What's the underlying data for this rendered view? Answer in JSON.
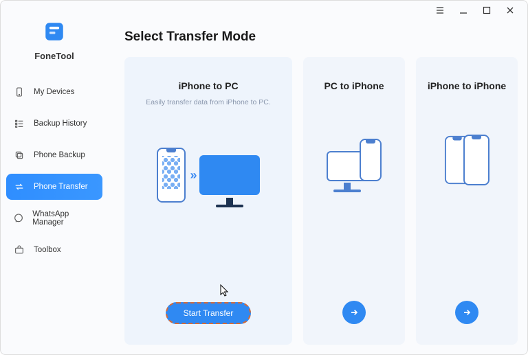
{
  "app": {
    "name": "FoneTool"
  },
  "sidebar": {
    "items": [
      {
        "label": "My Devices"
      },
      {
        "label": "Backup History"
      },
      {
        "label": "Phone Backup"
      },
      {
        "label": "Phone Transfer"
      },
      {
        "label": "WhatsApp Manager"
      },
      {
        "label": "Toolbox"
      }
    ],
    "active_index": 3
  },
  "main": {
    "title": "Select Transfer Mode",
    "cards": [
      {
        "title": "iPhone to PC",
        "subtitle": "Easily transfer data from iPhone to PC.",
        "cta": "Start Transfer"
      },
      {
        "title": "PC to iPhone"
      },
      {
        "title": "iPhone to iPhone"
      }
    ]
  }
}
